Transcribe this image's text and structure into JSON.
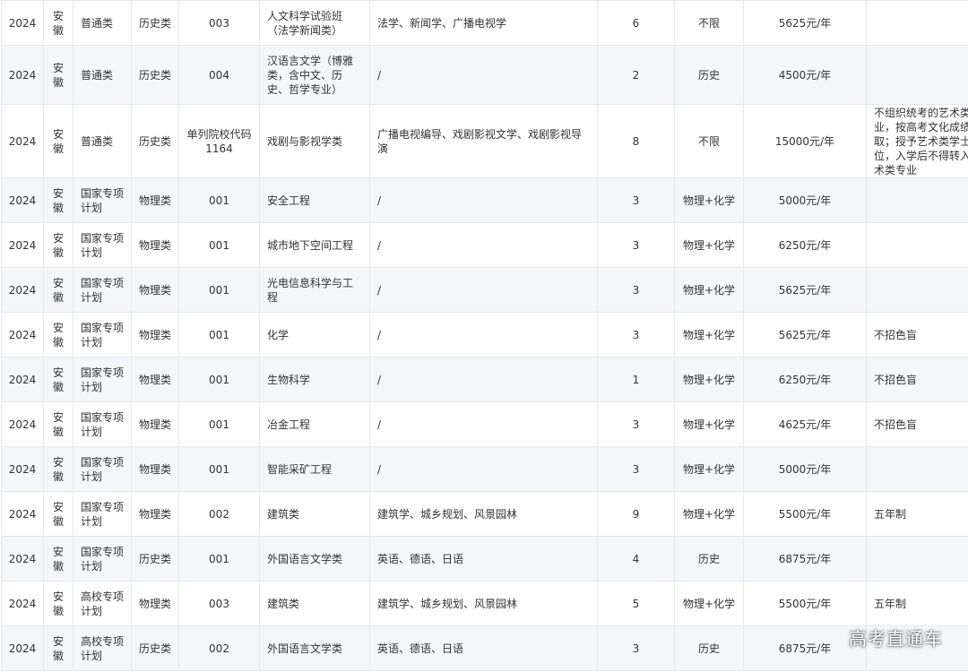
{
  "rows": [
    {
      "year": "2024",
      "province": "安徽",
      "type": "普通类",
      "subject": "历史类",
      "code": "003",
      "major": "人文科学试验班（法学新闻类）",
      "includes": "法学、新闻学、广播电视学",
      "count": "6",
      "requirement": "不限",
      "tuition": "5625元/年",
      "note": ""
    },
    {
      "year": "2024",
      "province": "安徽",
      "type": "普通类",
      "subject": "历史类",
      "code": "004",
      "major": "汉语言文学（博雅类，含中文、历史、哲学专业）",
      "includes": "/",
      "count": "2",
      "requirement": "历史",
      "tuition": "4500元/年",
      "note": ""
    },
    {
      "year": "2024",
      "province": "安徽",
      "type": "普通类",
      "subject": "历史类",
      "code": "单列院校代码1164",
      "major": "戏剧与影视学类",
      "includes": "广播电视编导、戏剧影视文学、戏剧影视导演",
      "count": "8",
      "requirement": "不限",
      "tuition": "15000元/年",
      "note": "不组织统考的艺术类专业，按高考文化成绩录取；授予艺术类学士学位，入学后不得转入非艺术类专业"
    },
    {
      "year": "2024",
      "province": "安徽",
      "type": "国家专项计划",
      "subject": "物理类",
      "code": "001",
      "major": "安全工程",
      "includes": "/",
      "count": "3",
      "requirement": "物理+化学",
      "tuition": "5000元/年",
      "note": ""
    },
    {
      "year": "2024",
      "province": "安徽",
      "type": "国家专项计划",
      "subject": "物理类",
      "code": "001",
      "major": "城市地下空间工程",
      "includes": "/",
      "count": "3",
      "requirement": "物理+化学",
      "tuition": "6250元/年",
      "note": ""
    },
    {
      "year": "2024",
      "province": "安徽",
      "type": "国家专项计划",
      "subject": "物理类",
      "code": "001",
      "major": "光电信息科学与工程",
      "includes": "/",
      "count": "3",
      "requirement": "物理+化学",
      "tuition": "5625元/年",
      "note": ""
    },
    {
      "year": "2024",
      "province": "安徽",
      "type": "国家专项计划",
      "subject": "物理类",
      "code": "001",
      "major": "化学",
      "includes": "/",
      "count": "3",
      "requirement": "物理+化学",
      "tuition": "5625元/年",
      "note": "不招色盲"
    },
    {
      "year": "2024",
      "province": "安徽",
      "type": "国家专项计划",
      "subject": "物理类",
      "code": "001",
      "major": "生物科学",
      "includes": "/",
      "count": "1",
      "requirement": "物理+化学",
      "tuition": "6250元/年",
      "note": "不招色盲"
    },
    {
      "year": "2024",
      "province": "安徽",
      "type": "国家专项计划",
      "subject": "物理类",
      "code": "001",
      "major": "冶金工程",
      "includes": "/",
      "count": "3",
      "requirement": "物理+化学",
      "tuition": "4625元/年",
      "note": "不招色盲"
    },
    {
      "year": "2024",
      "province": "安徽",
      "type": "国家专项计划",
      "subject": "物理类",
      "code": "001",
      "major": "智能采矿工程",
      "includes": "/",
      "count": "3",
      "requirement": "物理+化学",
      "tuition": "5000元/年",
      "note": ""
    },
    {
      "year": "2024",
      "province": "安徽",
      "type": "国家专项计划",
      "subject": "物理类",
      "code": "002",
      "major": "建筑类",
      "includes": "建筑学、城乡规划、风景园林",
      "count": "9",
      "requirement": "物理+化学",
      "tuition": "5500元/年",
      "note": "五年制"
    },
    {
      "year": "2024",
      "province": "安徽",
      "type": "国家专项计划",
      "subject": "历史类",
      "code": "001",
      "major": "外国语言文学类",
      "includes": "英语、德语、日语",
      "count": "4",
      "requirement": "历史",
      "tuition": "6875元/年",
      "note": ""
    },
    {
      "year": "2024",
      "province": "安徽",
      "type": "高校专项计划",
      "subject": "物理类",
      "code": "003",
      "major": "建筑类",
      "includes": "建筑学、城乡规划、风景园林",
      "count": "5",
      "requirement": "物理+化学",
      "tuition": "5500元/年",
      "note": "五年制"
    },
    {
      "year": "2024",
      "province": "安徽",
      "type": "高校专项计划",
      "subject": "历史类",
      "code": "002",
      "major": "外国语言文学类",
      "includes": "英语、德语、日语",
      "count": "3",
      "requirement": "历史",
      "tuition": "6875元/年",
      "note": ""
    }
  ],
  "watermark": "高考直通车"
}
